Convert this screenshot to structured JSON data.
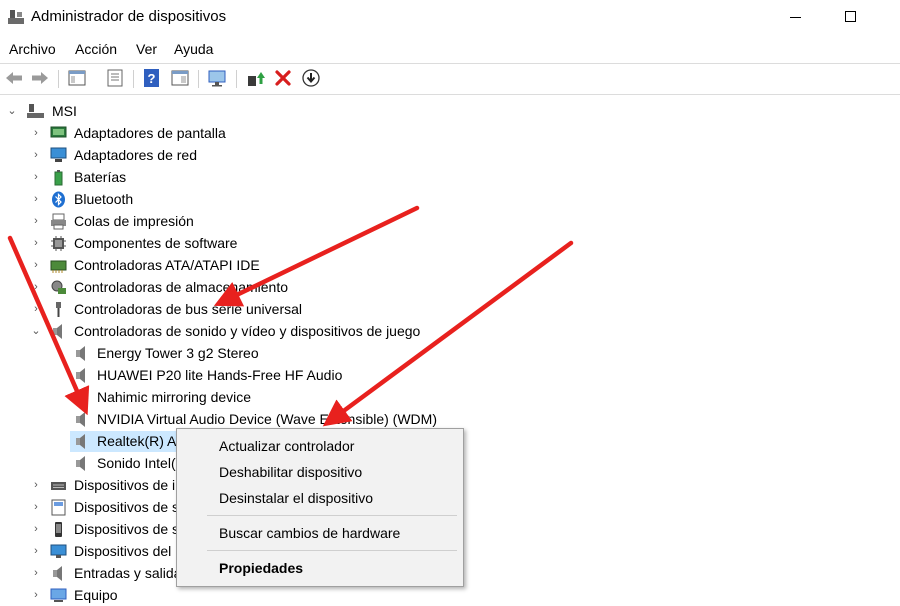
{
  "window": {
    "title": "Administrador de dispositivos",
    "minimize_icon": "minimize-icon",
    "maximize_icon": "maximize-icon"
  },
  "menu": [
    "Archivo",
    "Acción",
    "Ver",
    "Ayuda"
  ],
  "toolbar": {
    "icons": [
      "back-arrow-icon",
      "forward-arrow-icon",
      "show-hide-console-tree-icon",
      "properties-icon",
      "help-icon",
      "action-pane-icon",
      "scan-hardware-icon",
      "update-driver-icon",
      "uninstall-icon",
      "download-icon"
    ]
  },
  "tree": {
    "root": "MSI",
    "categories": [
      "Adaptadores de pantalla",
      "Adaptadores de red",
      "Baterías",
      "Bluetooth",
      "Colas de impresión",
      "Componentes de software",
      "Controladoras ATA/ATAPI IDE",
      "Controladoras de almacenamiento",
      "Controladoras de bus serie universal",
      "Controladoras de sonido y vídeo y dispositivos de juego"
    ],
    "sound_devices": [
      "Energy Tower 3 g2 Stereo",
      "HUAWEI P20 lite Hands-Free HF Audio",
      "Nahimic mirroring device",
      "NVIDIA Virtual Audio Device (Wave Extensible) (WDM)",
      "Realtek(R) Au",
      "Sonido Intel("
    ],
    "categories_after": [
      "Dispositivos de i",
      "Dispositivos de s",
      "Dispositivos de s",
      "Dispositivos del",
      "Entradas y salida",
      "Equipo"
    ]
  },
  "context_menu": {
    "update_driver": "Actualizar controlador",
    "disable_device": "Deshabilitar dispositivo",
    "uninstall_device": "Desinstalar el dispositivo",
    "scan_hardware": "Buscar cambios de hardware",
    "properties": "Propiedades"
  },
  "colors": {
    "selection": "#cce8ff",
    "arrow": "#e8211e",
    "uninstall_x": "#d81e1e"
  }
}
